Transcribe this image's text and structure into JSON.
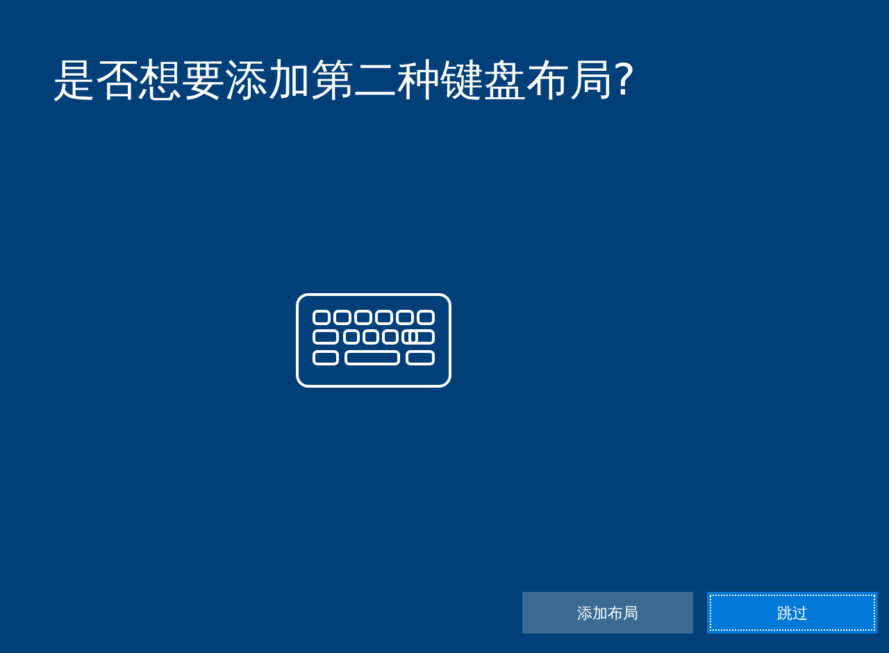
{
  "title": "是否想要添加第二种键盘布局?",
  "buttons": [
    {
      "label": "添加布局",
      "kind": "secondary",
      "focused": false
    },
    {
      "label": "跳过",
      "kind": "primary",
      "focused": true
    }
  ]
}
